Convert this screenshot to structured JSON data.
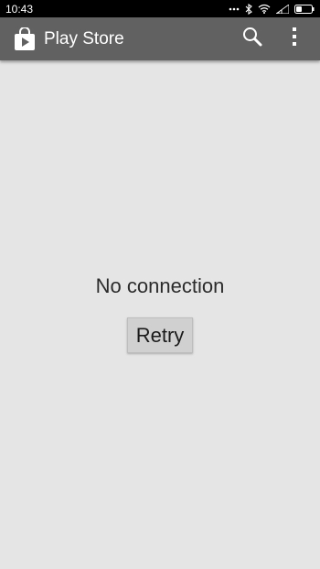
{
  "status_bar": {
    "time": "10:43",
    "icons": [
      "more-dots-icon",
      "bluetooth-icon",
      "wifi-icon",
      "signal-icon",
      "battery-icon"
    ]
  },
  "app_bar": {
    "title": "Play Store",
    "logo_icon": "play-store-bag-icon",
    "actions": [
      "search-icon",
      "overflow-menu-icon"
    ],
    "background": "#616161"
  },
  "main": {
    "message": "No connection",
    "retry_label": "Retry"
  },
  "colors": {
    "background": "#e5e5e5",
    "status_bar": "#000000",
    "button": "#d0d0d0"
  }
}
